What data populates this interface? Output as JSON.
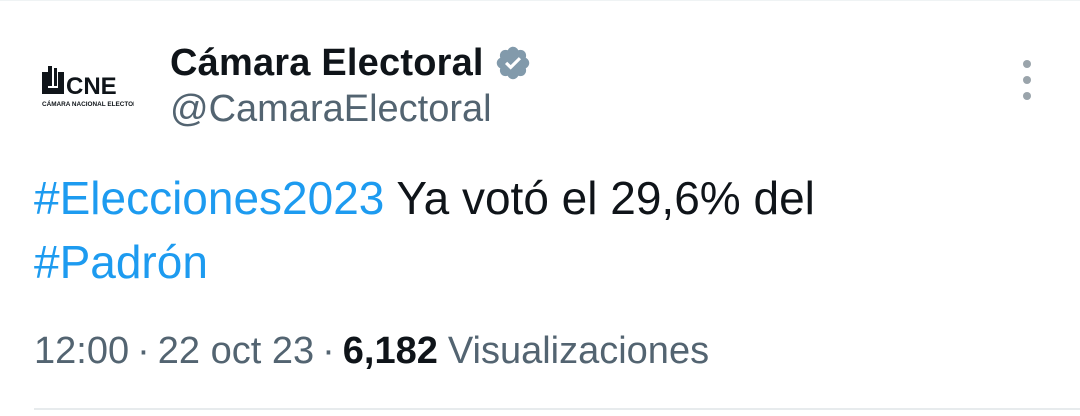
{
  "account": {
    "display_name": "Cámara Electoral",
    "handle": "@CamaraElectoral",
    "verified": true,
    "avatar": {
      "logo_text": "CNE",
      "logo_subtext": "CÁMARA NACIONAL ELECTORAL"
    }
  },
  "tweet": {
    "hashtag_1": "#Elecciones2023",
    "text": "Ya votó el 29,6% del",
    "hashtag_2": "#Padrón"
  },
  "meta": {
    "time": "12:00",
    "separator": "·",
    "date": "22 oct 23",
    "views_count": "6,182",
    "views_label": "Visualizaciones"
  },
  "colors": {
    "hashtag": "#1d9bf0",
    "verified_badge": "#829aab",
    "secondary_text": "#536471",
    "primary_text": "#0f1419"
  },
  "icons": {
    "verified": "verified-badge-icon",
    "more": "more-vertical-icon"
  }
}
